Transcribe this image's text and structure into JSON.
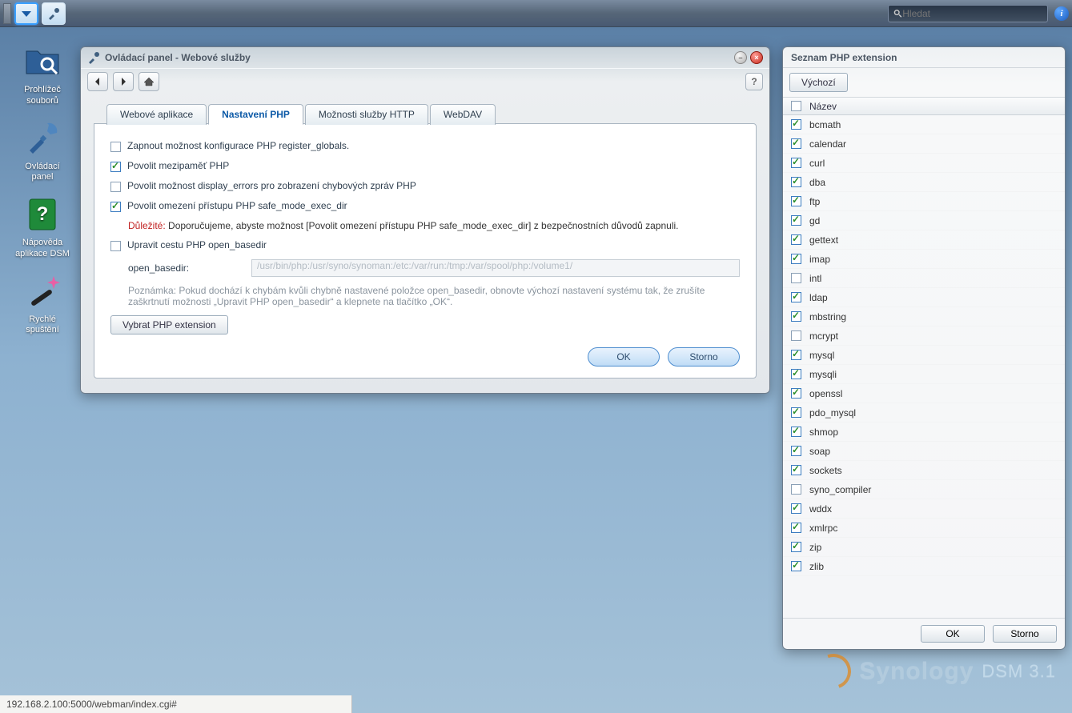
{
  "taskbar": {
    "search_placeholder": "Hledat"
  },
  "desktop": [
    {
      "id": "file-browser",
      "label": "Prohlížeč\nsouborů"
    },
    {
      "id": "control-panel",
      "label": "Ovládací\npanel"
    },
    {
      "id": "dsm-help",
      "label": "Nápověda\naplikace DSM"
    },
    {
      "id": "quick-start",
      "label": "Rychlé\nspuštění"
    }
  ],
  "window": {
    "title": "Ovládací panel - Webové služby",
    "tabs": [
      {
        "id": "web-apps",
        "label": "Webové aplikace",
        "active": false
      },
      {
        "id": "php-settings",
        "label": "Nastavení PHP",
        "active": true
      },
      {
        "id": "http-options",
        "label": "Možnosti služby HTTP",
        "active": false
      },
      {
        "id": "webdav",
        "label": "WebDAV",
        "active": false
      }
    ],
    "form": {
      "register_globals": {
        "checked": false,
        "label": "Zapnout možnost konfigurace PHP register_globals."
      },
      "php_cache": {
        "checked": true,
        "label": "Povolit mezipaměť PHP"
      },
      "display_errors": {
        "checked": false,
        "label": "Povolit možnost display_errors pro zobrazení chybových zpráv PHP"
      },
      "safe_mode": {
        "checked": true,
        "label": "Povolit omezení přístupu PHP safe_mode_exec_dir"
      },
      "important_prefix": "Důležité:",
      "important_text": " Doporučujeme, abyste možnost [Povolit omezení přístupu PHP safe_mode_exec_dir] z bezpečnostních důvodů zapnuli.",
      "open_basedir_edit": {
        "checked": false,
        "label": "Upravit cestu PHP open_basedir"
      },
      "open_basedir_label": "open_basedir:",
      "open_basedir_value": "/usr/bin/php:/usr/syno/synoman:/etc:/var/run:/tmp:/var/spool/php:/volume1/",
      "note": "Poznámka: Pokud dochází k chybám kvůli chybně nastavené položce open_basedir, obnovte výchozí nastavení systému tak, že zrušíte zaškrtnutí možnosti „Upravit PHP open_basedir“ a klepnete na tlačítko „OK“.",
      "select_ext_button": "Vybrat PHP extension",
      "ok": "OK",
      "cancel": "Storno"
    }
  },
  "ext_panel": {
    "title": "Seznam PHP extension",
    "default_btn": "Výchozí",
    "header": "Název",
    "ok": "OK",
    "cancel": "Storno",
    "items": [
      {
        "name": "bcmath",
        "checked": true
      },
      {
        "name": "calendar",
        "checked": true
      },
      {
        "name": "curl",
        "checked": true
      },
      {
        "name": "dba",
        "checked": true
      },
      {
        "name": "ftp",
        "checked": true
      },
      {
        "name": "gd",
        "checked": true
      },
      {
        "name": "gettext",
        "checked": true
      },
      {
        "name": "imap",
        "checked": true
      },
      {
        "name": "intl",
        "checked": false
      },
      {
        "name": "ldap",
        "checked": true
      },
      {
        "name": "mbstring",
        "checked": true
      },
      {
        "name": "mcrypt",
        "checked": false
      },
      {
        "name": "mysql",
        "checked": true
      },
      {
        "name": "mysqli",
        "checked": true
      },
      {
        "name": "openssl",
        "checked": true
      },
      {
        "name": "pdo_mysql",
        "checked": true
      },
      {
        "name": "shmop",
        "checked": true
      },
      {
        "name": "soap",
        "checked": true
      },
      {
        "name": "sockets",
        "checked": true
      },
      {
        "name": "syno_compiler",
        "checked": false
      },
      {
        "name": "wddx",
        "checked": true
      },
      {
        "name": "xmlrpc",
        "checked": true
      },
      {
        "name": "zip",
        "checked": true
      },
      {
        "name": "zlib",
        "checked": true
      }
    ]
  },
  "watermark": {
    "brand": "Synology",
    "product": "DSM 3.1"
  },
  "statusbar": "192.168.2.100:5000/webman/index.cgi#"
}
